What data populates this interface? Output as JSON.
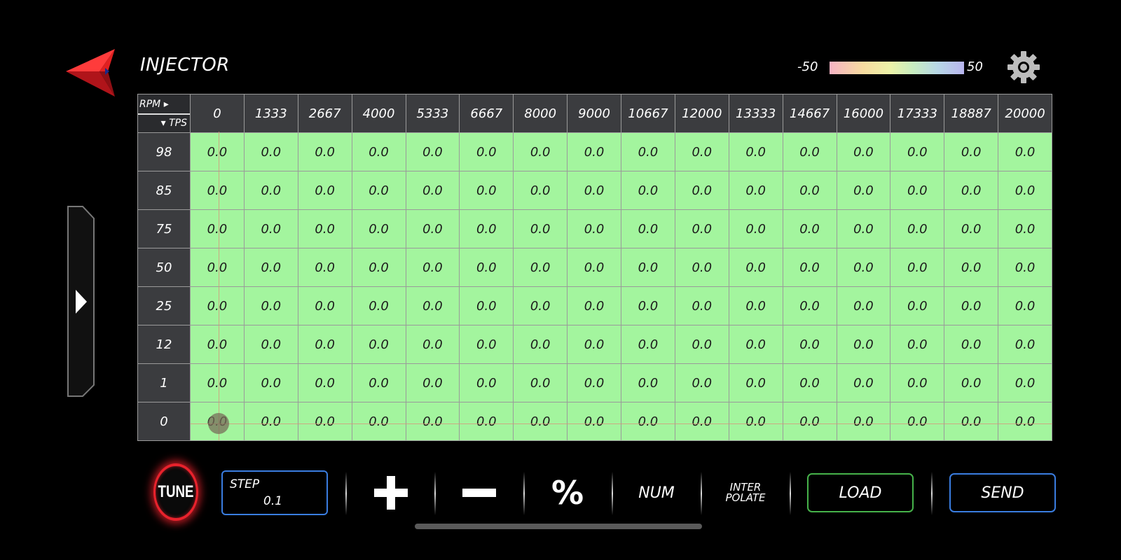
{
  "header": {
    "title": "INJECTOR",
    "legend_min": "-50",
    "legend_max": "50"
  },
  "table": {
    "corner_top": "RPM",
    "corner_bottom": "TPS",
    "rpm": [
      "0",
      "1333",
      "2667",
      "4000",
      "5333",
      "6667",
      "8000",
      "9000",
      "10667",
      "12000",
      "13333",
      "14667",
      "16000",
      "17333",
      "18887",
      "20000"
    ],
    "tps": [
      "98",
      "85",
      "75",
      "50",
      "25",
      "12",
      "1",
      "0"
    ],
    "cells": [
      [
        "0.0",
        "0.0",
        "0.0",
        "0.0",
        "0.0",
        "0.0",
        "0.0",
        "0.0",
        "0.0",
        "0.0",
        "0.0",
        "0.0",
        "0.0",
        "0.0",
        "0.0",
        "0.0"
      ],
      [
        "0.0",
        "0.0",
        "0.0",
        "0.0",
        "0.0",
        "0.0",
        "0.0",
        "0.0",
        "0.0",
        "0.0",
        "0.0",
        "0.0",
        "0.0",
        "0.0",
        "0.0",
        "0.0"
      ],
      [
        "0.0",
        "0.0",
        "0.0",
        "0.0",
        "0.0",
        "0.0",
        "0.0",
        "0.0",
        "0.0",
        "0.0",
        "0.0",
        "0.0",
        "0.0",
        "0.0",
        "0.0",
        "0.0"
      ],
      [
        "0.0",
        "0.0",
        "0.0",
        "0.0",
        "0.0",
        "0.0",
        "0.0",
        "0.0",
        "0.0",
        "0.0",
        "0.0",
        "0.0",
        "0.0",
        "0.0",
        "0.0",
        "0.0"
      ],
      [
        "0.0",
        "0.0",
        "0.0",
        "0.0",
        "0.0",
        "0.0",
        "0.0",
        "0.0",
        "0.0",
        "0.0",
        "0.0",
        "0.0",
        "0.0",
        "0.0",
        "0.0",
        "0.0"
      ],
      [
        "0.0",
        "0.0",
        "0.0",
        "0.0",
        "0.0",
        "0.0",
        "0.0",
        "0.0",
        "0.0",
        "0.0",
        "0.0",
        "0.0",
        "0.0",
        "0.0",
        "0.0",
        "0.0"
      ],
      [
        "0.0",
        "0.0",
        "0.0",
        "0.0",
        "0.0",
        "0.0",
        "0.0",
        "0.0",
        "0.0",
        "0.0",
        "0.0",
        "0.0",
        "0.0",
        "0.0",
        "0.0",
        "0.0"
      ],
      [
        "0.0",
        "0.0",
        "0.0",
        "0.0",
        "0.0",
        "0.0",
        "0.0",
        "0.0",
        "0.0",
        "0.0",
        "0.0",
        "0.0",
        "0.0",
        "0.0",
        "0.0",
        "0.0"
      ]
    ],
    "cell_color": "#a3f59e"
  },
  "toolbar": {
    "tune_label": "TUNE",
    "step_label": "STEP",
    "step_value": "0.1",
    "percent_label": "%",
    "num_label": "NUM",
    "interpolate_line1": "INTER",
    "interpolate_line2": "POLATE",
    "load_label": "LOAD",
    "send_label": "SEND"
  },
  "icons": {
    "back": "red-arrow-back-icon",
    "settings": "gear-icon",
    "drawer": "chevron-right-icon",
    "plus": "plus-icon",
    "minus": "minus-icon"
  },
  "colors": {
    "accent_red": "#e8222c",
    "accent_blue": "#3a7de0",
    "accent_green": "#46b24a"
  }
}
